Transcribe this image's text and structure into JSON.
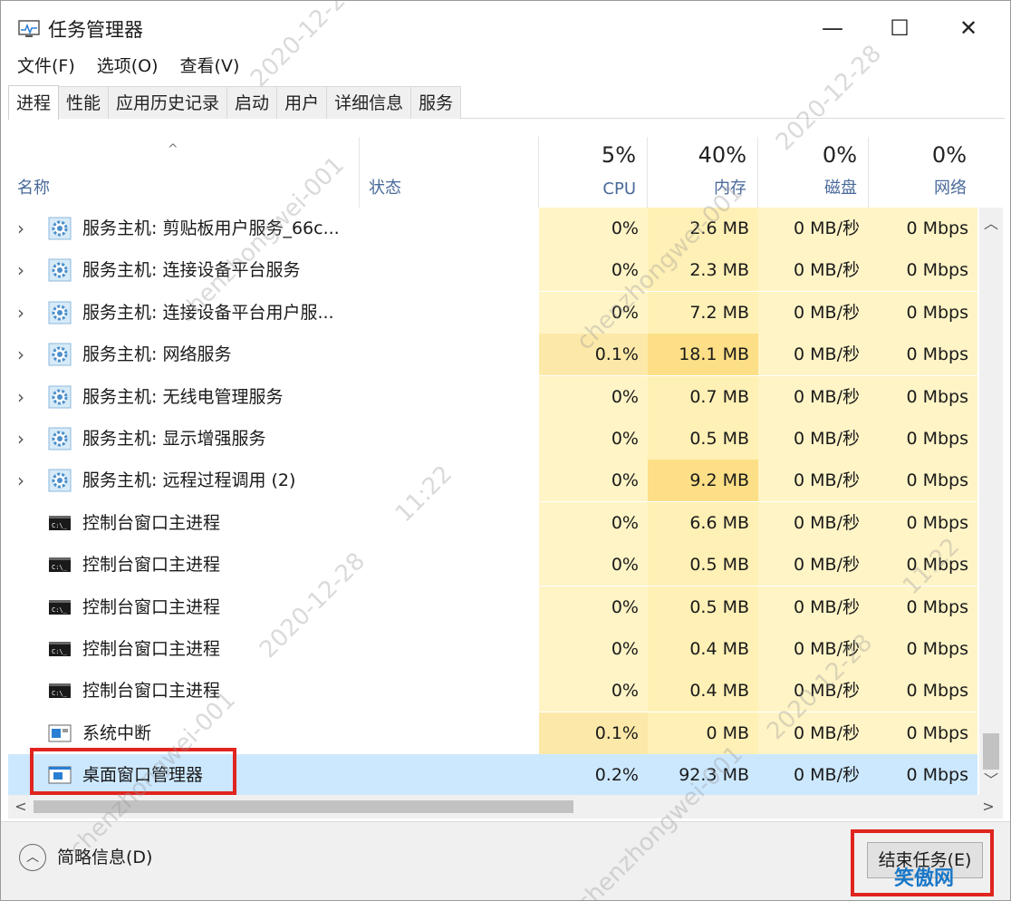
{
  "window": {
    "title": "任务管理器",
    "minimize_glyph": "—",
    "maximize_glyph": "☐",
    "close_glyph": "✕"
  },
  "menu": [
    "文件(F)",
    "选项(O)",
    "查看(V)"
  ],
  "tabs": [
    "进程",
    "性能",
    "应用历史记录",
    "启动",
    "用户",
    "详细信息",
    "服务"
  ],
  "active_tab": "进程",
  "columns": {
    "name": "名称",
    "status": "状态",
    "cpu": {
      "percent": "5%",
      "label": "CPU"
    },
    "memory": {
      "percent": "40%",
      "label": "内存"
    },
    "disk": {
      "percent": "0%",
      "label": "磁盘"
    },
    "network": {
      "percent": "0%",
      "label": "网络"
    }
  },
  "rows": [
    {
      "expandable": true,
      "icon": "gear-icon",
      "name": "服务主机: 剪贴板用户服务_66c...",
      "cpu": "0%",
      "memory": "2.6 MB",
      "disk": "0 MB/秒",
      "network": "0 Mbps"
    },
    {
      "expandable": true,
      "icon": "gear-icon",
      "name": "服务主机: 连接设备平台服务",
      "cpu": "0%",
      "memory": "2.3 MB",
      "disk": "0 MB/秒",
      "network": "0 Mbps"
    },
    {
      "expandable": true,
      "icon": "gear-icon",
      "name": "服务主机: 连接设备平台用户服...",
      "cpu": "0%",
      "memory": "7.2 MB",
      "disk": "0 MB/秒",
      "network": "0 Mbps"
    },
    {
      "expandable": true,
      "icon": "gear-icon",
      "name": "服务主机: 网络服务",
      "cpu": "0.1%",
      "memory": "18.1 MB",
      "disk": "0 MB/秒",
      "network": "0 Mbps"
    },
    {
      "expandable": true,
      "icon": "gear-icon",
      "name": "服务主机: 无线电管理服务",
      "cpu": "0%",
      "memory": "0.7 MB",
      "disk": "0 MB/秒",
      "network": "0 Mbps"
    },
    {
      "expandable": true,
      "icon": "gear-icon",
      "name": "服务主机: 显示增强服务",
      "cpu": "0%",
      "memory": "0.5 MB",
      "disk": "0 MB/秒",
      "network": "0 Mbps"
    },
    {
      "expandable": true,
      "icon": "gear-icon",
      "name": "服务主机: 远程过程调用 (2)",
      "cpu": "0%",
      "memory": "9.2 MB",
      "disk": "0 MB/秒",
      "network": "0 Mbps"
    },
    {
      "expandable": false,
      "icon": "console-icon",
      "name": "控制台窗口主进程",
      "cpu": "0%",
      "memory": "6.6 MB",
      "disk": "0 MB/秒",
      "network": "0 Mbps"
    },
    {
      "expandable": false,
      "icon": "console-icon",
      "name": "控制台窗口主进程",
      "cpu": "0%",
      "memory": "0.5 MB",
      "disk": "0 MB/秒",
      "network": "0 Mbps"
    },
    {
      "expandable": false,
      "icon": "console-icon",
      "name": "控制台窗口主进程",
      "cpu": "0%",
      "memory": "0.5 MB",
      "disk": "0 MB/秒",
      "network": "0 Mbps"
    },
    {
      "expandable": false,
      "icon": "console-icon",
      "name": "控制台窗口主进程",
      "cpu": "0%",
      "memory": "0.4 MB",
      "disk": "0 MB/秒",
      "network": "0 Mbps"
    },
    {
      "expandable": false,
      "icon": "console-icon",
      "name": "控制台窗口主进程",
      "cpu": "0%",
      "memory": "0.4 MB",
      "disk": "0 MB/秒",
      "network": "0 Mbps"
    },
    {
      "expandable": false,
      "icon": "interrupts-icon",
      "name": "系统中断",
      "cpu": "0.1%",
      "memory": "0 MB",
      "disk": "0 MB/秒",
      "network": "0 Mbps"
    },
    {
      "expandable": false,
      "icon": "window-manager-icon",
      "name": "桌面窗口管理器",
      "cpu": "0.2%",
      "memory": "92.3 MB",
      "disk": "0 MB/秒",
      "network": "0 Mbps",
      "selected": true
    }
  ],
  "footer": {
    "fewer_details": "简略信息(D)",
    "end_task": "结束任务(E)"
  },
  "watermark": {
    "date": "2020-12-28",
    "time": "11:22",
    "user": "chenzhongwei-001"
  },
  "logo_text": "笑傲网"
}
